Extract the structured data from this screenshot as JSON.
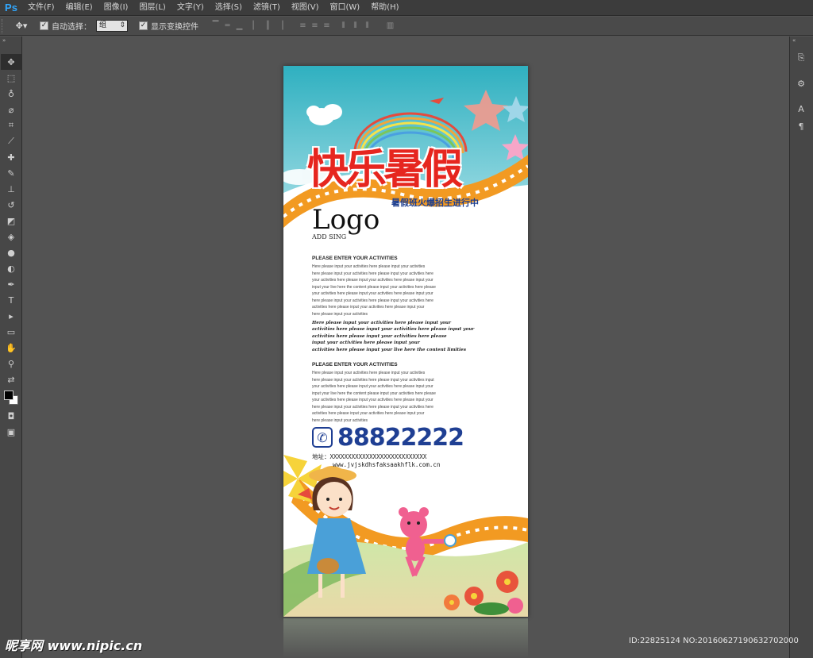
{
  "app": {
    "logo": "Ps"
  },
  "menubar": {
    "items": [
      "文件(F)",
      "编辑(E)",
      "图像(I)",
      "图层(L)",
      "文字(Y)",
      "选择(S)",
      "滤镜(T)",
      "视图(V)",
      "窗口(W)",
      "帮助(H)"
    ]
  },
  "optbar": {
    "auto_select_label": "自动选择：",
    "auto_select_value": "组",
    "show_transform_label": "显示变换控件"
  },
  "poster": {
    "title": "快乐暑假",
    "subtitle": "暑假班火爆招生进行中",
    "logo": "Logo",
    "logo_sub": "ADD SING",
    "section1": {
      "heading": "PLEASE ENTER YOUR ACTIVITIES",
      "lines": [
        "Here please input your activities here please input your activities",
        "here please input your activities here please input your activities here",
        "your activities here please input your activities here please input your",
        "input your live here the content please input your activities here please",
        "your activities here please input your activities here please input your",
        "here please input your activities here please input your activities here",
        "activities here please input your activities here please input your",
        "here please input your activities"
      ]
    },
    "script": {
      "lines": [
        "Here please input your activities here please input your",
        "activities here please input your activities here please input your",
        "activities here please input your activities here please",
        "input your activities here please input your",
        "activities here please input your live here the content limities"
      ]
    },
    "section2": {
      "heading": "PLEASE ENTER YOUR ACTIVITIES",
      "lines": [
        "Here please input your activities here please input your activities",
        "here please input your activities here please input your activities input",
        "your activities here please input your activities here please input your",
        "input your live here the content please input your activities here please",
        "your activities here please input your activities here please input your",
        "here please input your activities here please input your activities here",
        "activities here please input your activities here please input your",
        "here please input your activities"
      ]
    },
    "phone": "88822222",
    "address": "地址：XXXXXXXXXXXXXXXXXXXXXXXXXXX",
    "website": "www.jvjskdhsfaksaakhflk.com.cn"
  },
  "watermark": {
    "left": "昵享网 www.nipic.cn",
    "right": "ID:22825124 NO:20160627190632702000"
  },
  "colors": {
    "title_red": "#e6261f",
    "accent_blue": "#1f3f93",
    "sky": "#3cb6c6",
    "film_orange": "#f29a22"
  }
}
